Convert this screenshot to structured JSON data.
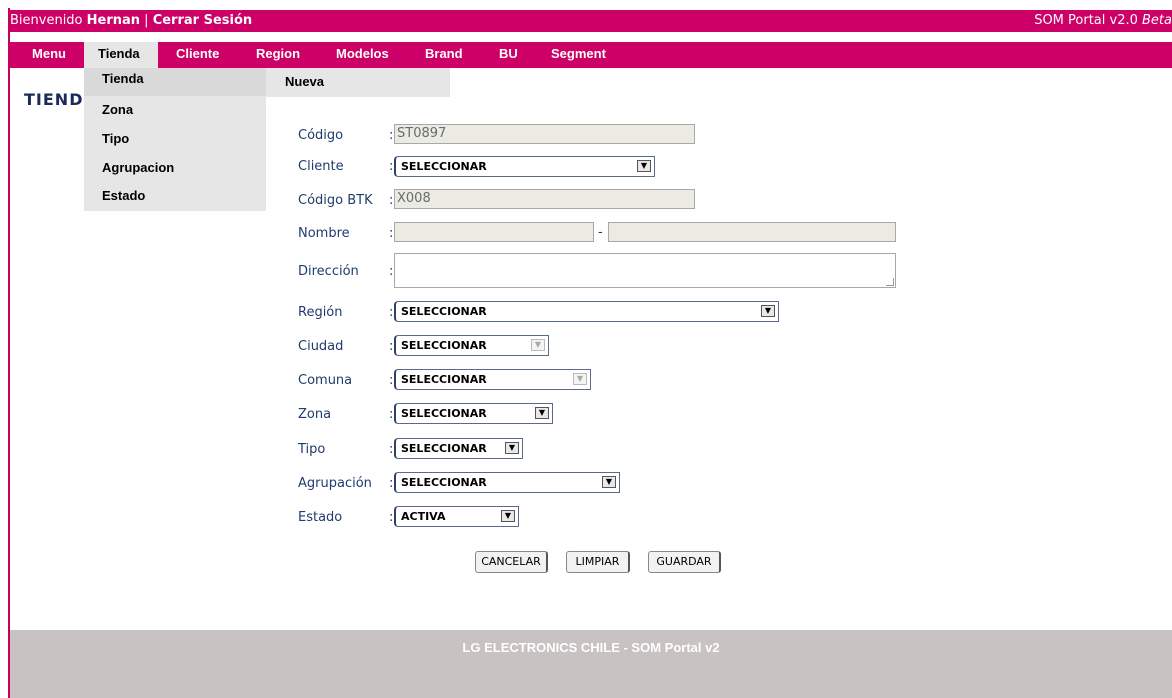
{
  "header": {
    "welcome_prefix": "Bienvenido ",
    "user": "Hernan",
    "separator": " | ",
    "logout": "Cerrar Sesión",
    "version": "SOM Portal v2.0 ",
    "version_tag": "Beta"
  },
  "nav": {
    "items": [
      "Menu",
      "Tienda",
      "Cliente",
      "Region",
      "Modelos",
      "Brand",
      "BU",
      "Segment"
    ],
    "active": "Tienda"
  },
  "dropdown": {
    "items": [
      "Tienda",
      "Zona",
      "Tipo",
      "Agrupacion",
      "Estado"
    ],
    "submenu": "Nueva"
  },
  "page_title": "TIEND",
  "form": {
    "codigo": {
      "label": "Código",
      "value": "ST0897"
    },
    "cliente": {
      "label": "Cliente",
      "value": "SELECCIONAR"
    },
    "codigo_btk": {
      "label": "Código BTK",
      "value": "X008"
    },
    "nombre": {
      "label": "Nombre",
      "value1": "",
      "dash": "-",
      "value2": ""
    },
    "direccion": {
      "label": "Dirección",
      "value": ""
    },
    "region": {
      "label": "Región",
      "value": "SELECCIONAR"
    },
    "ciudad": {
      "label": "Ciudad",
      "value": "SELECCIONAR"
    },
    "comuna": {
      "label": "Comuna",
      "value": "SELECCIONAR"
    },
    "zona": {
      "label": "Zona",
      "value": "SELECCIONAR"
    },
    "tipo": {
      "label": "Tipo",
      "value": "SELECCIONAR"
    },
    "agrupacion": {
      "label": "Agrupación",
      "value": "SELECCIONAR"
    },
    "estado": {
      "label": "Estado",
      "value": "ACTIVA"
    },
    "colon": ":"
  },
  "buttons": {
    "cancel": "CANCELAR",
    "clear": "LIMPIAR",
    "save": "GUARDAR"
  },
  "footer": "LG ELECTRONICS CHILE - SOM Portal v2",
  "colors": {
    "brand": "#cc0066",
    "footer": "#c8c2c2",
    "label": "#1f3c6e"
  }
}
